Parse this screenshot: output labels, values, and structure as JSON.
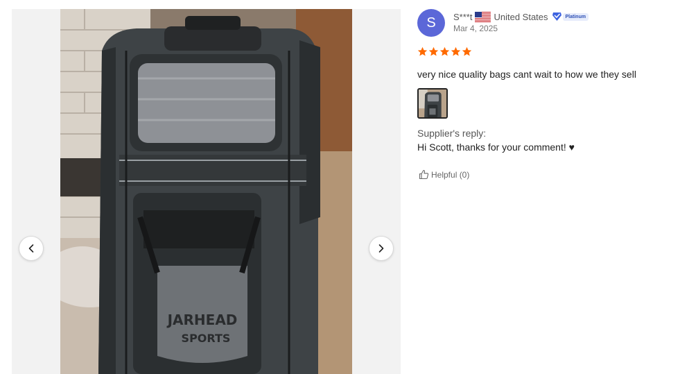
{
  "gallery": {
    "prev_icon": "chevron-left-icon",
    "next_icon": "chevron-right-icon",
    "photo_brand_text": "JARHEAD SPORTS"
  },
  "review": {
    "avatar_initial": "S",
    "reviewer_name": "S***t",
    "country_flag_icon": "us-flag-icon",
    "country": "United States",
    "badge_icon": "diamond-shield-icon",
    "badge_label": "Platinum",
    "date": "Mar 4, 2025",
    "rating": 5,
    "rating_max": 5,
    "comment": "very nice quality bags cant wait to how we they sell",
    "supplier_reply_label": "Supplier's reply:",
    "supplier_reply_text": "Hi Scott, thanks for your comment! ♥",
    "helpful_icon": "thumbs-up-icon",
    "helpful_label": "Helpful (0)"
  },
  "colors": {
    "avatar_bg": "#5b67d8",
    "star": "#ff6a00",
    "badge_text": "#2d4fb5"
  }
}
